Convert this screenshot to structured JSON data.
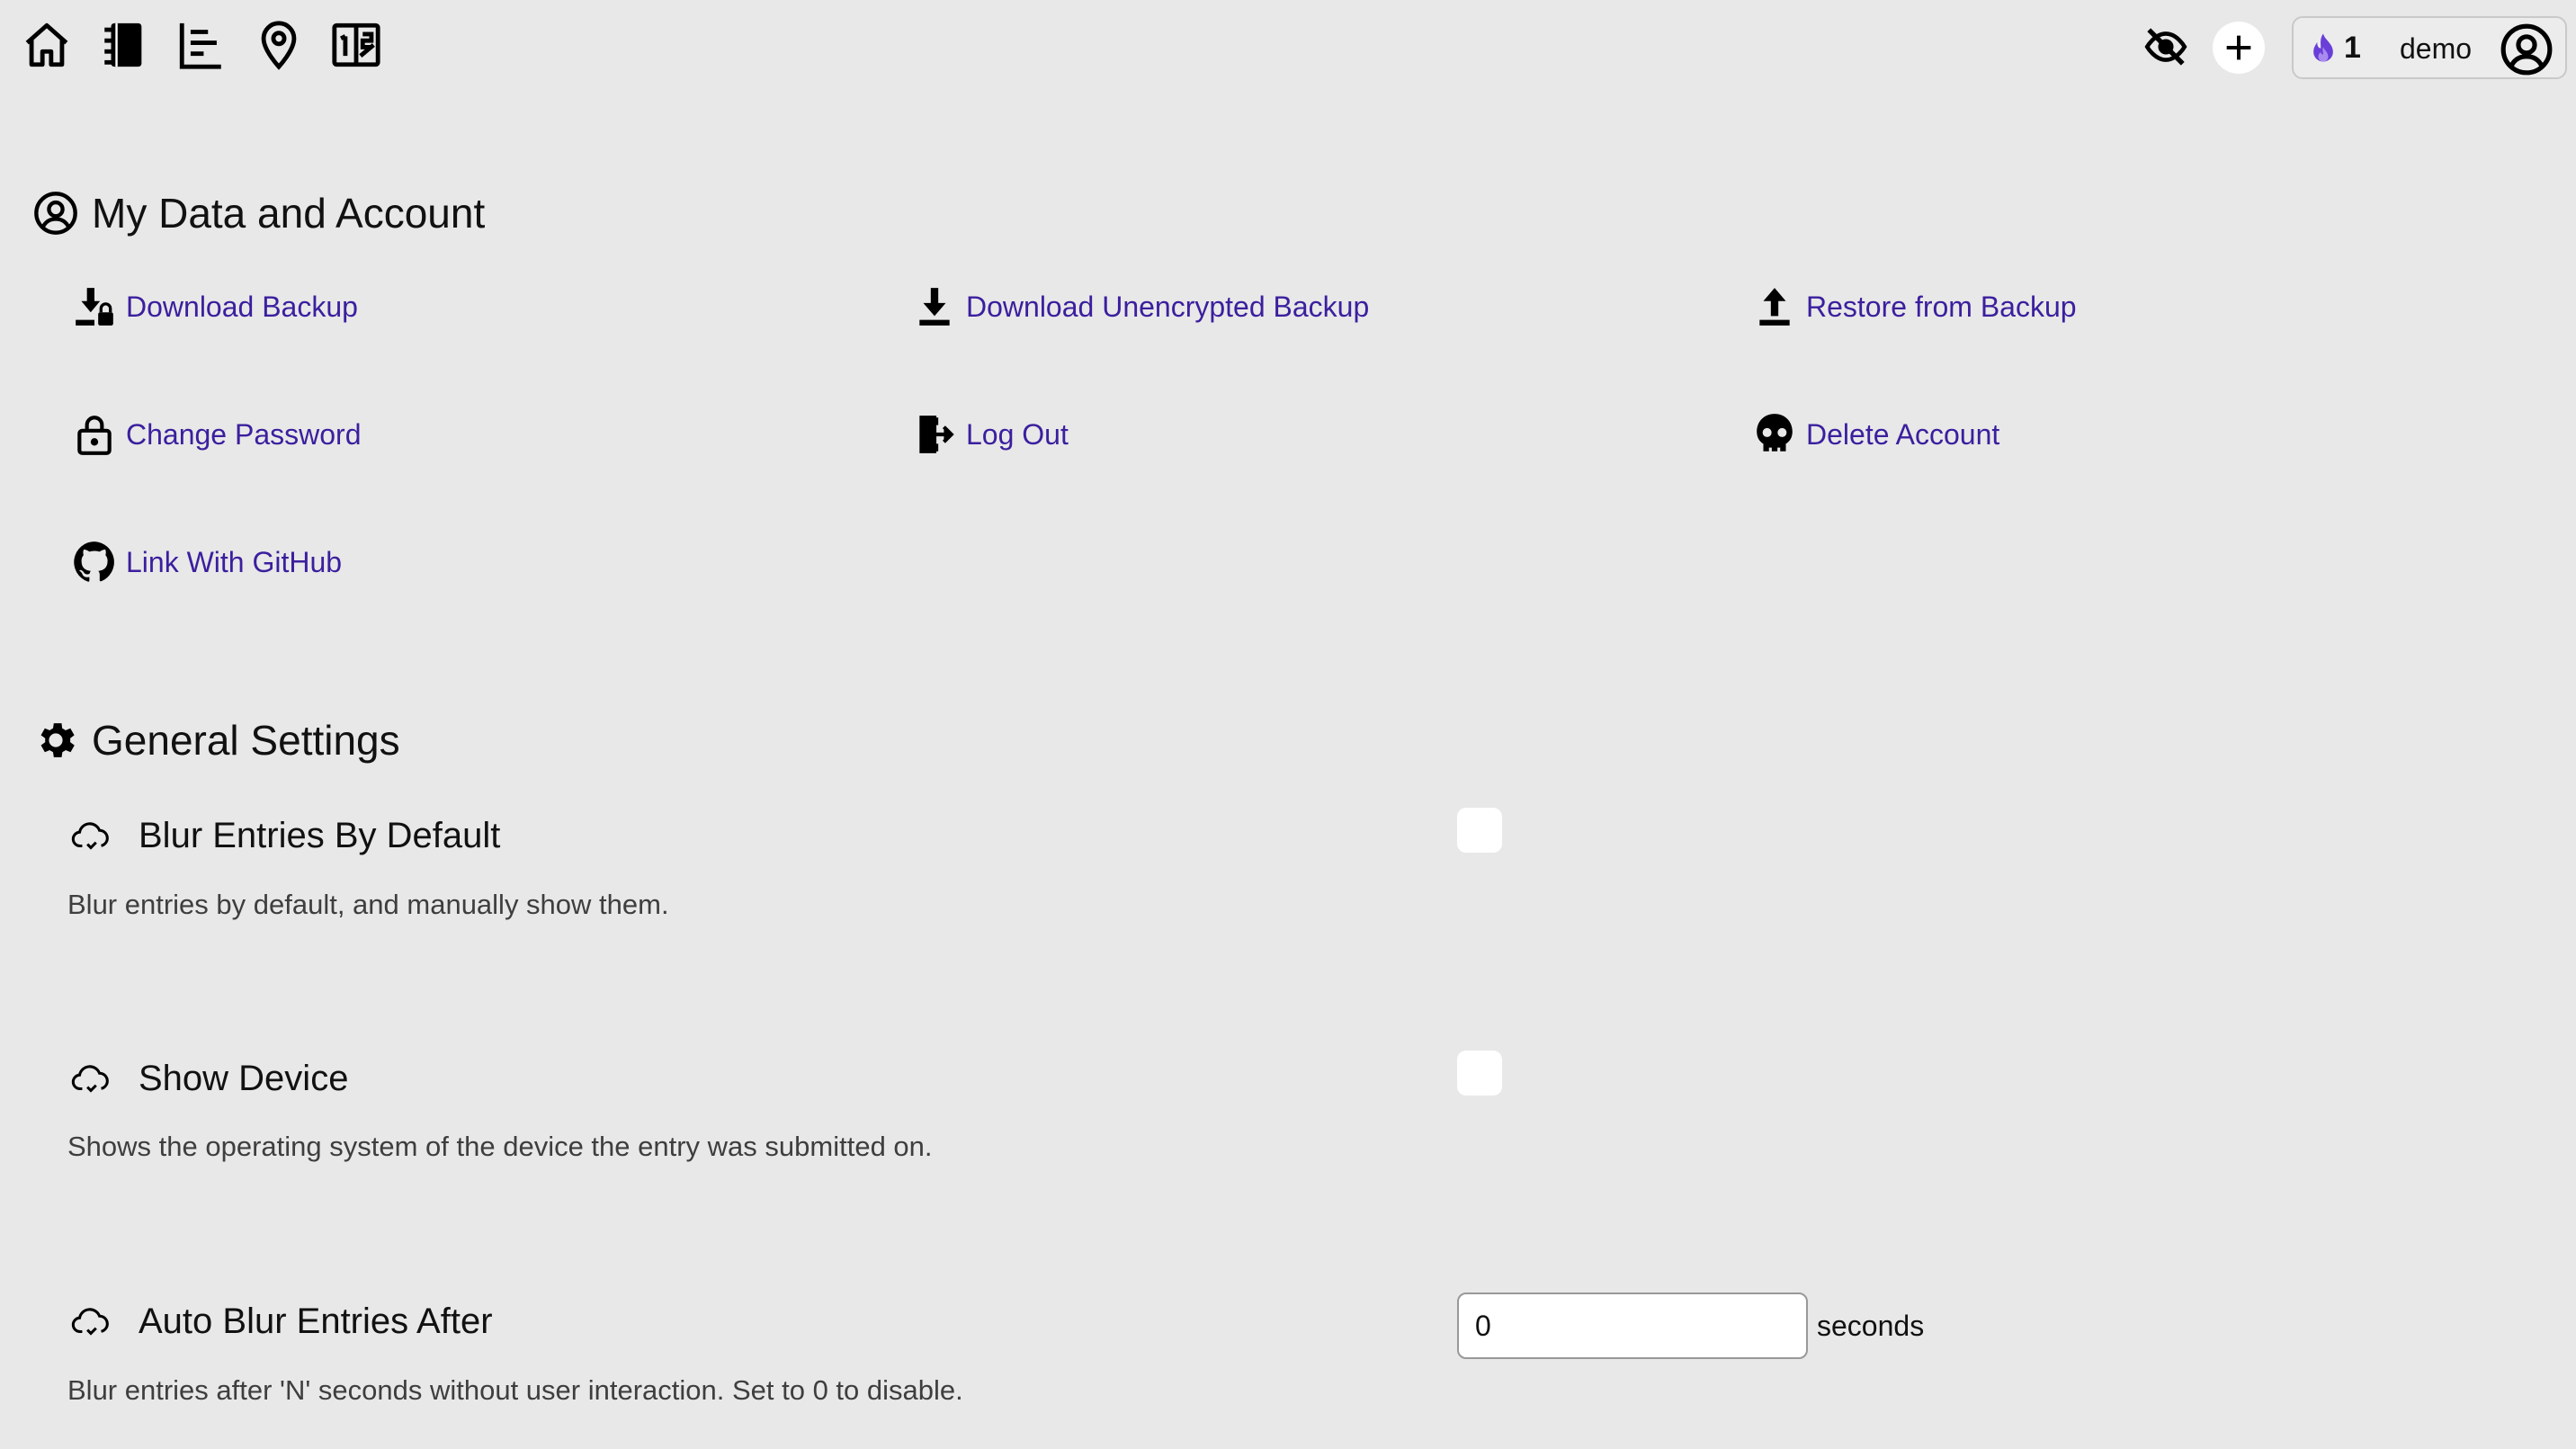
{
  "topbar": {
    "streak_count": "1",
    "username": "demo",
    "flame_color": "#6a3fd8"
  },
  "account": {
    "title": "My Data and Account",
    "actions": [
      {
        "label": "Download Backup",
        "icon": "download-lock-icon"
      },
      {
        "label": "Download Unencrypted Backup",
        "icon": "download-icon"
      },
      {
        "label": "Restore from Backup",
        "icon": "upload-icon"
      },
      {
        "label": "Change Password",
        "icon": "lock-icon"
      },
      {
        "label": "Log Out",
        "icon": "logout-icon"
      },
      {
        "label": "Delete Account",
        "icon": "skull-icon"
      },
      {
        "label": "Link With GitHub",
        "icon": "github-icon"
      }
    ]
  },
  "general": {
    "title": "General Settings",
    "settings": [
      {
        "title": "Blur Entries By Default",
        "description": "Blur entries by default, and manually show them.",
        "checked": false
      },
      {
        "title": "Show Device",
        "description": "Shows the operating system of the device the entry was submitted on.",
        "checked": false
      },
      {
        "title": "Auto Blur Entries After",
        "description": "Blur entries after 'N' seconds without user interaction. Set to 0 to disable.",
        "value": "0",
        "unit": "seconds"
      }
    ]
  },
  "colors": {
    "background": "#e8e8e8",
    "link": "#3b1f9e"
  }
}
